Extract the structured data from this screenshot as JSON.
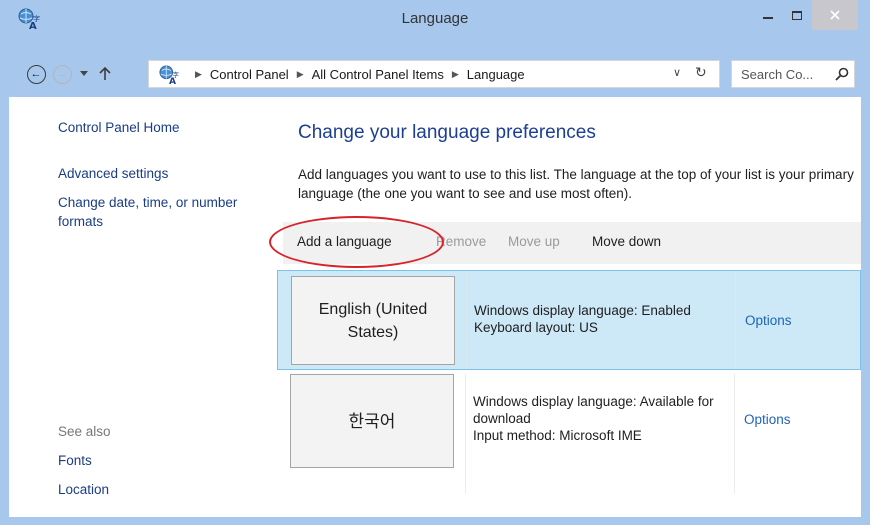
{
  "window": {
    "title": "Language",
    "icons": {
      "app": "language-globe-icon",
      "minimize": "minimize-icon",
      "maximize": "maximize-icon",
      "close": "close-icon"
    }
  },
  "navigation": {
    "icons": [
      "back-arrow-icon",
      "forward-arrow-icon",
      "recent-locations-chevron-icon",
      "up-arrow-icon"
    ],
    "address": {
      "crumbs": [
        "Control Panel",
        "All Control Panel Items",
        "Language"
      ],
      "dropdown_icon": "chevron-down-icon",
      "refresh_icon": "refresh-icon"
    },
    "search": {
      "placeholder": "Search Co...",
      "icon": "magnifier-icon"
    }
  },
  "left_nav": {
    "home": "Control Panel Home",
    "links": [
      "Advanced settings",
      "Change date, time, or number formats"
    ],
    "see_also_label": "See also",
    "see_also": [
      "Fonts",
      "Location"
    ]
  },
  "main": {
    "heading": "Change your language preferences",
    "description": "Add languages you want to use to this list. The language at the top of your list is your primary language (the one you want to see and use most often).",
    "toolbar": {
      "add": "Add a language",
      "remove": "Remove",
      "move_up": "Move up",
      "move_down": "Move down"
    },
    "languages": [
      {
        "name": "English (United States)",
        "info": [
          "Windows display language: Enabled",
          "Keyboard layout: US"
        ],
        "options": "Options",
        "selected": true
      },
      {
        "name": "한국어",
        "info": [
          "Windows display language: Available for download",
          "Input method: Microsoft IME"
        ],
        "options": "Options",
        "selected": false
      }
    ]
  },
  "colors": {
    "frame": "#a7c8ec",
    "link": "#1a3d86",
    "heading": "#1c3f94",
    "selected_row": "#cde8f7",
    "highlight_ring": "#d6242a",
    "close_button": "#c7c7cd"
  }
}
